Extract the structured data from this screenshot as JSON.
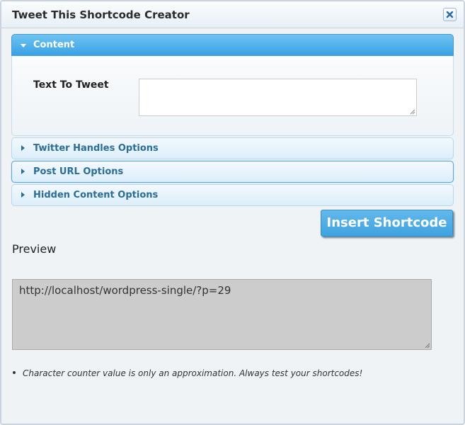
{
  "dialog": {
    "title": "Tweet This Shortcode Creator",
    "close_icon": "close-icon"
  },
  "content_section": {
    "label": "Content",
    "expanded": true,
    "field_label": "Text To Tweet",
    "text_value": ""
  },
  "sections": [
    {
      "label": "Twitter Handles Options",
      "expanded": false
    },
    {
      "label": "Post URL Options",
      "expanded": false,
      "focused": true
    },
    {
      "label": "Hidden Content Options",
      "expanded": false
    }
  ],
  "insert_button": {
    "label": "Insert Shortcode"
  },
  "preview": {
    "heading": "Preview",
    "value": "http://localhost/wordpress-single/?p=29"
  },
  "notes": [
    "Character counter value is only an approximation. Always test your shortcodes!"
  ],
  "colors": {
    "accent": "#3ea3e0",
    "header_text": "#2b6d94",
    "preview_bg": "#cccccc"
  }
}
